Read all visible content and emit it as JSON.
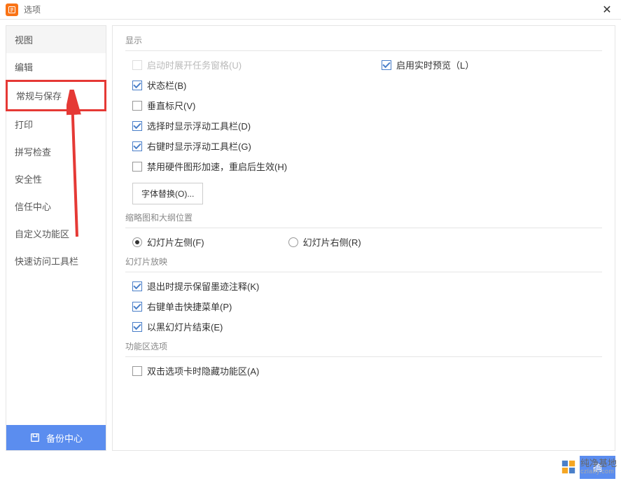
{
  "titlebar": {
    "title": "选项"
  },
  "sidebar": {
    "items": [
      {
        "label": "视图",
        "active": true
      },
      {
        "label": "编辑"
      },
      {
        "label": "常规与保存",
        "highlight": true
      },
      {
        "label": "打印"
      },
      {
        "label": "拼写检查"
      },
      {
        "label": "安全性"
      },
      {
        "label": "信任中心"
      },
      {
        "label": "自定义功能区"
      },
      {
        "label": "快速访问工具栏"
      }
    ],
    "backup_label": "备份中心"
  },
  "sections": {
    "display": {
      "title": "显示",
      "show_task_pane": "启动时展开任务窗格(U)",
      "realtime_preview": "启用实时预览（L）",
      "status_bar": "状态栏(B)",
      "vertical_ruler": "垂直标尺(V)",
      "float_toolbar_select": "选择时显示浮动工具栏(D)",
      "float_toolbar_right": "右键时显示浮动工具栏(G)",
      "disable_hw_accel": "禁用硬件图形加速，重启后生效(H)",
      "font_replace_btn": "字体替换(O)..."
    },
    "thumbnail": {
      "title": "缩略图和大纲位置",
      "left": "幻灯片左侧(F)",
      "right": "幻灯片右侧(R)"
    },
    "slideshow": {
      "title": "幻灯片放映",
      "exit_ink": "退出时提示保留墨迹注释(K)",
      "right_click_menu": "右键单击快捷菜单(P)",
      "black_end": "以黑幻灯片结束(E)"
    },
    "ribbon": {
      "title": "功能区选项",
      "dbl_click_hide": "双击选项卡时隐藏功能区(A)"
    }
  },
  "footer": {
    "ok_label": "确"
  },
  "watermark": {
    "main": "纯净基地",
    "sub": "czlaby.com"
  }
}
